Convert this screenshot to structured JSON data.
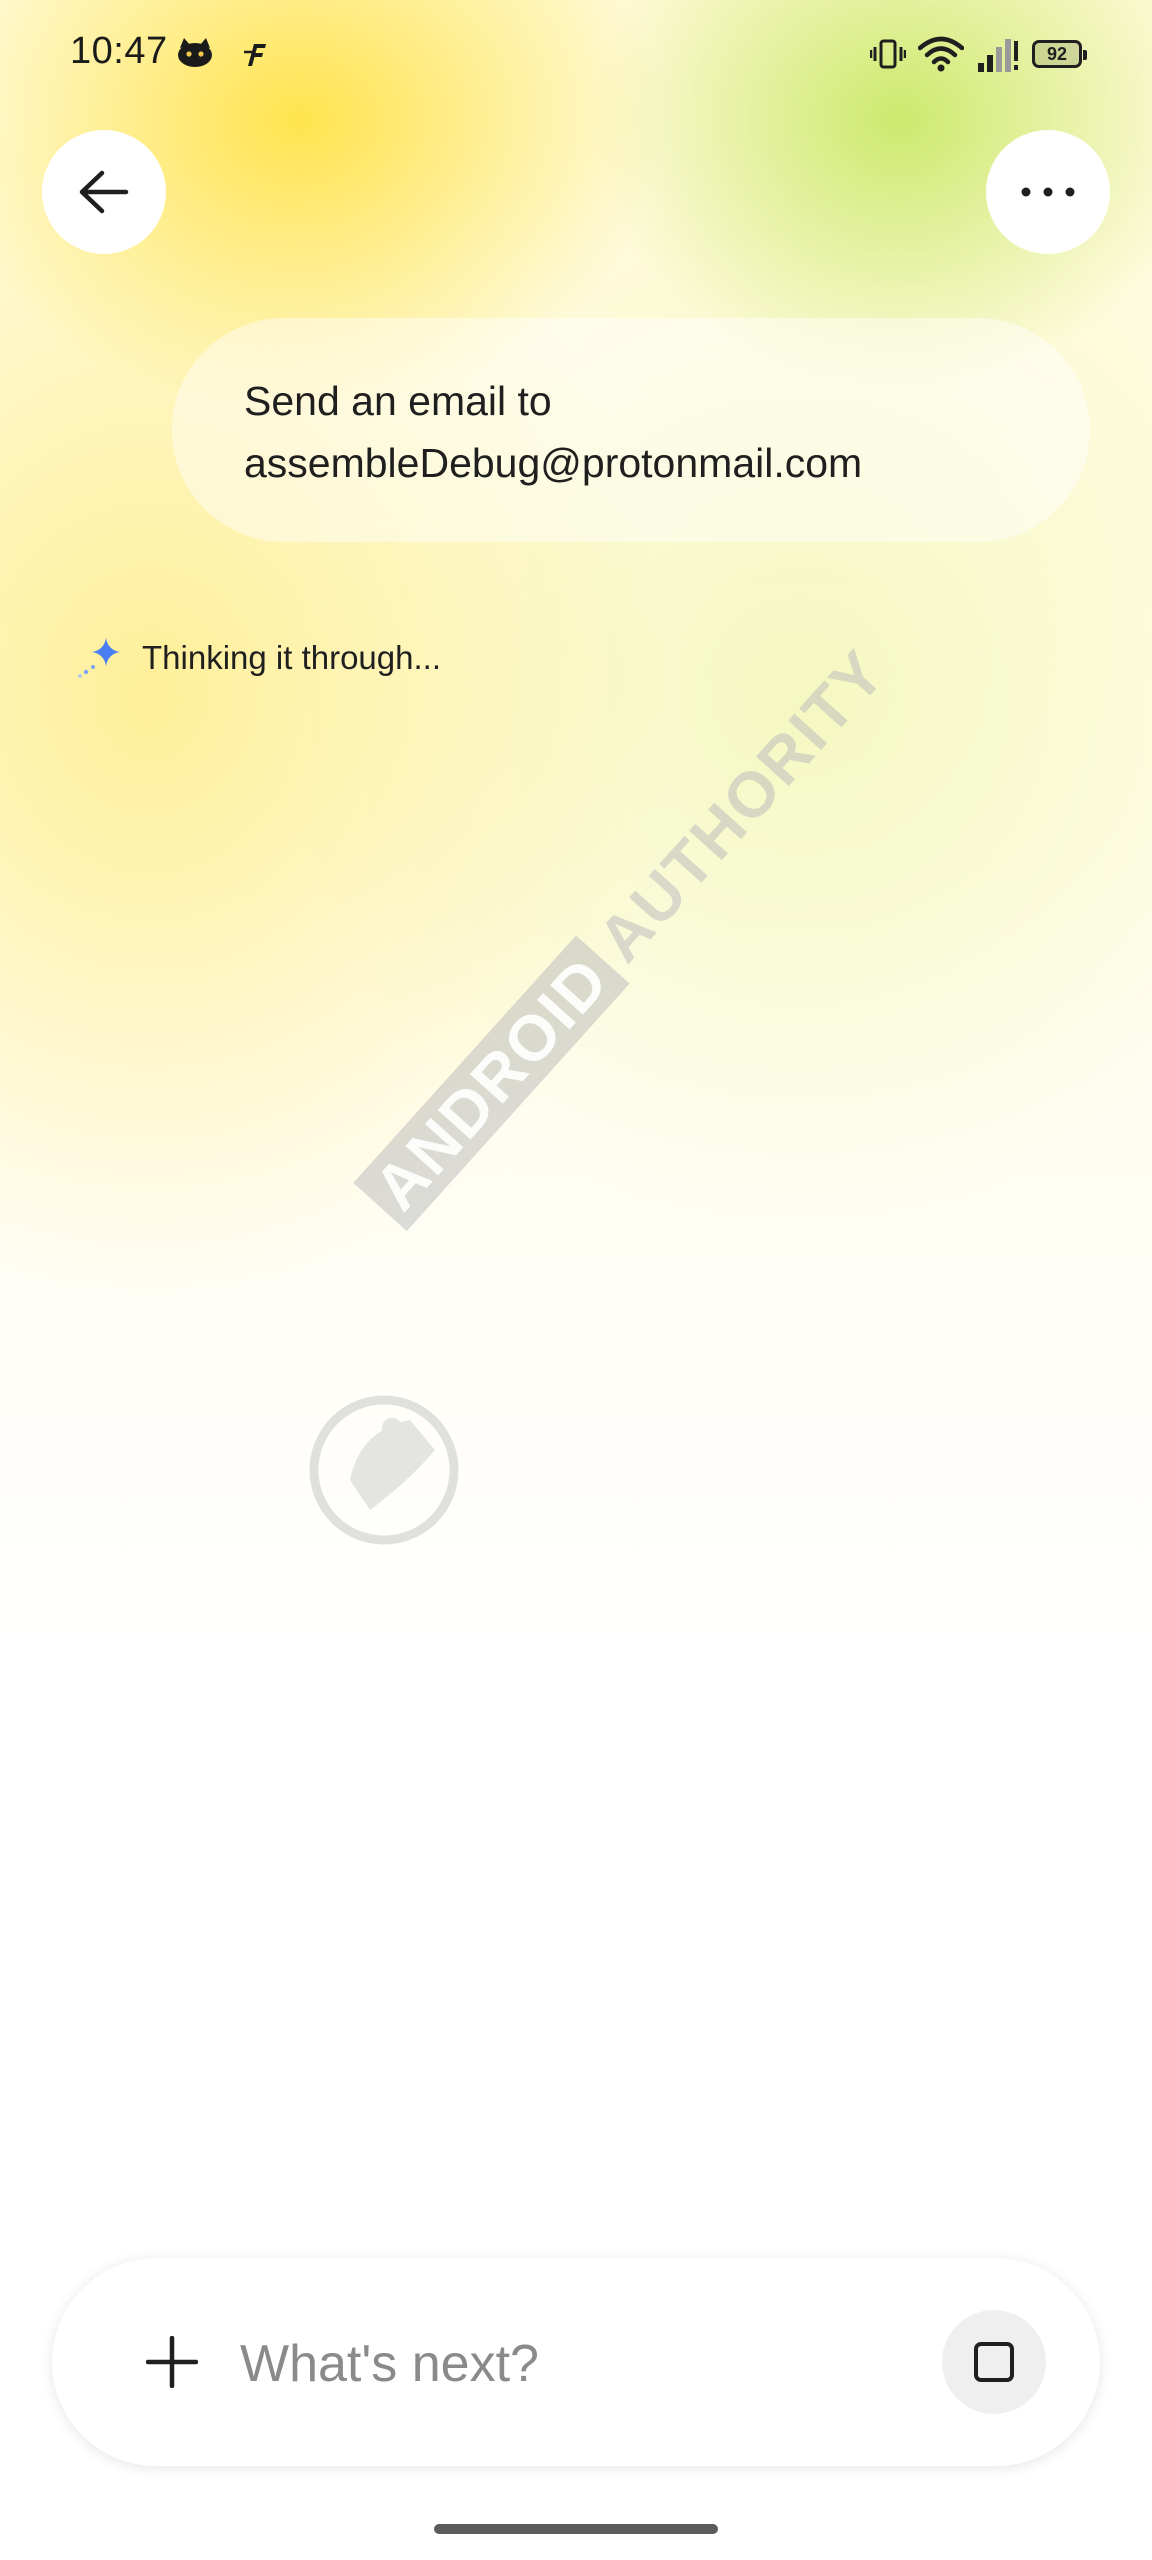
{
  "status_bar": {
    "time": "10:47",
    "battery_level": "92",
    "icons": [
      "cat-app-icon",
      "f-app-icon",
      "vibrate-icon",
      "wifi-icon",
      "cell-signal-icon",
      "battery-icon"
    ]
  },
  "header": {
    "back_icon": "arrow-left-icon",
    "more_icon": "more-horizontal-icon"
  },
  "conversation": {
    "user_prompt": "Send an email to\nassembleDebug@protonmail.com",
    "status_text": "Thinking it through..."
  },
  "watermark": {
    "text_boxed": "ANDROID",
    "text": "AUTHORITY"
  },
  "input": {
    "placeholder": "What's next?",
    "value": "",
    "add_icon": "plus-icon",
    "stop_icon": "stop-icon"
  },
  "colors": {
    "accent_gradient_yellow": "#FFE246",
    "accent_gradient_green": "#C4E65A",
    "sparkle_blue": "#4A7FF2",
    "text_primary": "#1F1F1F",
    "placeholder": "#8A8A8A"
  }
}
